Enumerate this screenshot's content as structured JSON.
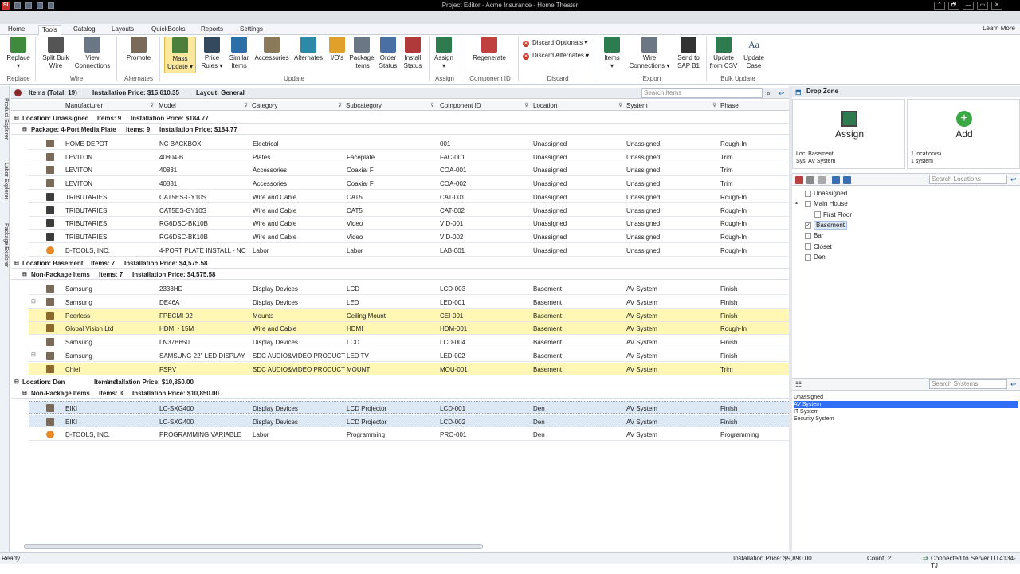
{
  "window": {
    "title": "Project Editor - Acme Insurance - Home Theater",
    "app_logo": "SI",
    "controls": [
      "⌃",
      "🗗",
      "—",
      "▭",
      "✕"
    ]
  },
  "tabs": [
    "Home",
    "Tools",
    "Catalog",
    "Layouts",
    "QuickBooks",
    "Reports",
    "Settings"
  ],
  "learn_more": "Learn More",
  "ribbon": {
    "buttons": [
      {
        "label": "Replace",
        "sub": "▾"
      },
      {
        "label": "Split Bulk",
        "sub": "Wire"
      },
      {
        "label": "View",
        "sub": "Connections"
      },
      {
        "label": "Promote",
        "sub": ""
      },
      {
        "label": "Mass",
        "sub": "Update ▾"
      },
      {
        "label": "Price",
        "sub": "Rules ▾"
      },
      {
        "label": "Similar",
        "sub": "Items"
      },
      {
        "label": "Accessories",
        "sub": ""
      },
      {
        "label": "Alternates",
        "sub": ""
      },
      {
        "label": "I/O's",
        "sub": ""
      },
      {
        "label": "Package",
        "sub": "Items"
      },
      {
        "label": "Order",
        "sub": "Status"
      },
      {
        "label": "Install",
        "sub": "Status"
      },
      {
        "label": "Assign",
        "sub": "▾"
      },
      {
        "label": "Regenerate",
        "sub": ""
      },
      {
        "label": "Items",
        "sub": "▾"
      },
      {
        "label": "Wire",
        "sub": "Connections ▾"
      },
      {
        "label": "Send to",
        "sub": "SAP B1"
      },
      {
        "label": "Update",
        "sub": "from CSV"
      },
      {
        "label": "Update",
        "sub": "Case"
      }
    ],
    "small": [
      "Discard Optionals ▾",
      "Discard Alternates ▾"
    ],
    "groups": [
      "Replace",
      "Wire",
      "Alternates",
      "Update",
      "Assign",
      "Component ID",
      "Discard",
      "Export",
      "Bulk Update"
    ]
  },
  "sidebar_tabs": [
    "Product Explorer",
    "Labor Explorer",
    "Package Explorer"
  ],
  "items_bar": {
    "title": "Items (Total: 19)",
    "price": "Installation Price: $15,610.35",
    "layout": "Layout: General"
  },
  "search_items_placeholder": "Search Items",
  "columns": [
    "Manufacturer",
    "Model",
    "Category",
    "Subcategory",
    "Component ID",
    "Location",
    "System",
    "Phase"
  ],
  "groups": [
    {
      "header": "Location: Unassigned",
      "items": "Items: 9",
      "price": "Installation Price: $184.77",
      "sub": {
        "header": "Package: 4-Port Media Plate",
        "items": "Items: 9",
        "price": "Installation Price: $184.77"
      },
      "rows": [
        {
          "icon": "product",
          "mfr": "HOME DEPOT",
          "model": "NC BACKBOX",
          "cat": "Electrical",
          "sub": "",
          "cid": "001",
          "loc": "Unassigned",
          "sys": "Unassigned",
          "phase": "Rough-In",
          "style": ""
        },
        {
          "icon": "product",
          "mfr": "LEVITON",
          "model": "40804-B",
          "cat": "Plates",
          "sub": "Faceplate",
          "cid": "FAC-001",
          "loc": "Unassigned",
          "sys": "Unassigned",
          "phase": "Trim",
          "style": ""
        },
        {
          "icon": "product",
          "mfr": "LEVITON",
          "model": "40831",
          "cat": "Accessories",
          "sub": "Coaxial F",
          "cid": "COA-001",
          "loc": "Unassigned",
          "sys": "Unassigned",
          "phase": "Trim",
          "style": ""
        },
        {
          "icon": "product",
          "mfr": "LEVITON",
          "model": "40831",
          "cat": "Accessories",
          "sub": "Coaxial F",
          "cid": "COA-002",
          "loc": "Unassigned",
          "sys": "Unassigned",
          "phase": "Trim",
          "style": ""
        },
        {
          "icon": "wire",
          "mfr": "TRIBUTARIES",
          "model": "CAT5ES-GY10S",
          "cat": "Wire and Cable",
          "sub": "CAT5",
          "cid": "CAT-001",
          "loc": "Unassigned",
          "sys": "Unassigned",
          "phase": "Rough-In",
          "style": ""
        },
        {
          "icon": "wire",
          "mfr": "TRIBUTARIES",
          "model": "CAT5ES-GY10S",
          "cat": "Wire and Cable",
          "sub": "CAT5",
          "cid": "CAT-002",
          "loc": "Unassigned",
          "sys": "Unassigned",
          "phase": "Rough-In",
          "style": ""
        },
        {
          "icon": "wire",
          "mfr": "TRIBUTARIES",
          "model": "RG6DSC-BK10B",
          "cat": "Wire and Cable",
          "sub": "Video",
          "cid": "VID-001",
          "loc": "Unassigned",
          "sys": "Unassigned",
          "phase": "Rough-In",
          "style": ""
        },
        {
          "icon": "wire",
          "mfr": "TRIBUTARIES",
          "model": "RG6DSC-BK10B",
          "cat": "Wire and Cable",
          "sub": "Video",
          "cid": "VID-002",
          "loc": "Unassigned",
          "sys": "Unassigned",
          "phase": "Rough-In",
          "style": ""
        },
        {
          "icon": "labor",
          "mfr": "D-TOOLS, INC.",
          "model": "4-PORT PLATE INSTALL - NC",
          "cat": "Labor",
          "sub": "Labor",
          "cid": "LAB-001",
          "loc": "Unassigned",
          "sys": "Unassigned",
          "phase": "Rough-In",
          "style": ""
        }
      ]
    },
    {
      "header": "Location: Basement",
      "items": "Items: 7",
      "price": "Installation Price: $4,575.58",
      "sub": {
        "header": "Non-Package Items",
        "items": "Items: 7",
        "price": "Installation Price: $4,575.58"
      },
      "rows": [
        {
          "icon": "product",
          "mfr": "Samsung",
          "model": "2333HD",
          "cat": "Display Devices",
          "sub": "LCD",
          "cid": "LCD-003",
          "loc": "Basement",
          "sys": "AV System",
          "phase": "Finish",
          "style": ""
        },
        {
          "icon": "product",
          "mfr": "Samsung",
          "model": "DE46A",
          "cat": "Display Devices",
          "sub": "LED",
          "cid": "LED-001",
          "loc": "Basement",
          "sys": "AV System",
          "phase": "Finish",
          "style": "",
          "expander": "⊟"
        },
        {
          "icon": "mount",
          "mfr": "Peerless",
          "model": "FPECMI-02",
          "cat": "Mounts",
          "sub": "Ceiling Mount",
          "cid": "CEI-001",
          "loc": "Basement",
          "sys": "AV System",
          "phase": "Finish",
          "style": "yellow"
        },
        {
          "icon": "mount",
          "mfr": "Global Vision Ltd",
          "model": "HDMI - 15M",
          "cat": "Wire and Cable",
          "sub": "HDMI",
          "cid": "HDM-001",
          "loc": "Basement",
          "sys": "AV System",
          "phase": "Rough-In",
          "style": "yellow"
        },
        {
          "icon": "product",
          "mfr": "Samsung",
          "model": "LN37B650",
          "cat": "Display Devices",
          "sub": "LCD",
          "cid": "LCD-004",
          "loc": "Basement",
          "sys": "AV System",
          "phase": "Finish",
          "style": ""
        },
        {
          "icon": "product",
          "mfr": "Samsung",
          "model": "SAMSUNG 22\" LED DISPLAY",
          "cat": "SDC AUDIO&VIDEO PRODUCT",
          "sub": "LED TV",
          "cid": "LED-002",
          "loc": "Basement",
          "sys": "AV System",
          "phase": "Finish",
          "style": "",
          "expander": "⊟"
        },
        {
          "icon": "mount",
          "mfr": "Chief",
          "model": "FSRV",
          "cat": "SDC AUDIO&VIDEO PRODUCTS",
          "sub": "MOUNT",
          "cid": "MOU-001",
          "loc": "Basement",
          "sys": "AV System",
          "phase": "Trim",
          "style": "yellow"
        }
      ]
    },
    {
      "header": "Location: Den",
      "items": "Items: 3",
      "price": "Installation Price: $10,850.00",
      "sub": {
        "header": "Non-Package Items",
        "items": "Items: 3",
        "price": "Installation Price: $10,850.00"
      },
      "rows": [
        {
          "icon": "product",
          "mfr": "EIKI",
          "model": "LC-SXG400",
          "cat": "Display Devices",
          "sub": "LCD Projector",
          "cid": "LCD-001",
          "loc": "Den",
          "sys": "AV System",
          "phase": "Finish",
          "style": "sel"
        },
        {
          "icon": "product",
          "mfr": "EIKI",
          "model": "LC-SXG400",
          "cat": "Display Devices",
          "sub": "LCD Projector",
          "cid": "LCD-002",
          "loc": "Den",
          "sys": "AV System",
          "phase": "Finish",
          "style": "sel"
        },
        {
          "icon": "labor",
          "mfr": "D-TOOLS, INC.",
          "model": "PROGRAMMING VARIABLE",
          "cat": "Labor",
          "sub": "Programming",
          "cid": "PRO-001",
          "loc": "Den",
          "sys": "AV System",
          "phase": "Programming",
          "style": ""
        }
      ]
    }
  ],
  "dropzone": {
    "title": "Drop Zone",
    "assign": "Assign",
    "add": "Add",
    "assign_info": [
      "Loc: Basement",
      "Sys: AV System"
    ],
    "add_info": [
      "1 location(s)",
      "1 system"
    ]
  },
  "search_locations_placeholder": "Search Locations",
  "locations": [
    {
      "label": "Unassigned",
      "level": 0,
      "checked": false,
      "expander": ""
    },
    {
      "label": "Main House",
      "level": 0,
      "checked": false,
      "expander": "▴"
    },
    {
      "label": "First Floor",
      "level": 1,
      "checked": false,
      "expander": ""
    },
    {
      "label": "Basement",
      "level": 0,
      "checked": true,
      "expander": "",
      "selected": true
    },
    {
      "label": "Bar",
      "level": 0,
      "checked": false,
      "expander": ""
    },
    {
      "label": "Closet",
      "level": 0,
      "checked": false,
      "expander": ""
    },
    {
      "label": "Den",
      "level": 0,
      "checked": false,
      "expander": ""
    }
  ],
  "search_systems_placeholder": "Search Systems",
  "systems": [
    {
      "label": "Unassigned",
      "selected": false
    },
    {
      "label": "AV System",
      "selected": true
    },
    {
      "label": "IT System",
      "selected": false
    },
    {
      "label": "Security System",
      "selected": false
    }
  ],
  "statusbar": {
    "left": "Ready",
    "price": "Installation Price: $9,890.00",
    "count": "Count: 2",
    "server": "Connected to Server DT4134-TJ"
  }
}
